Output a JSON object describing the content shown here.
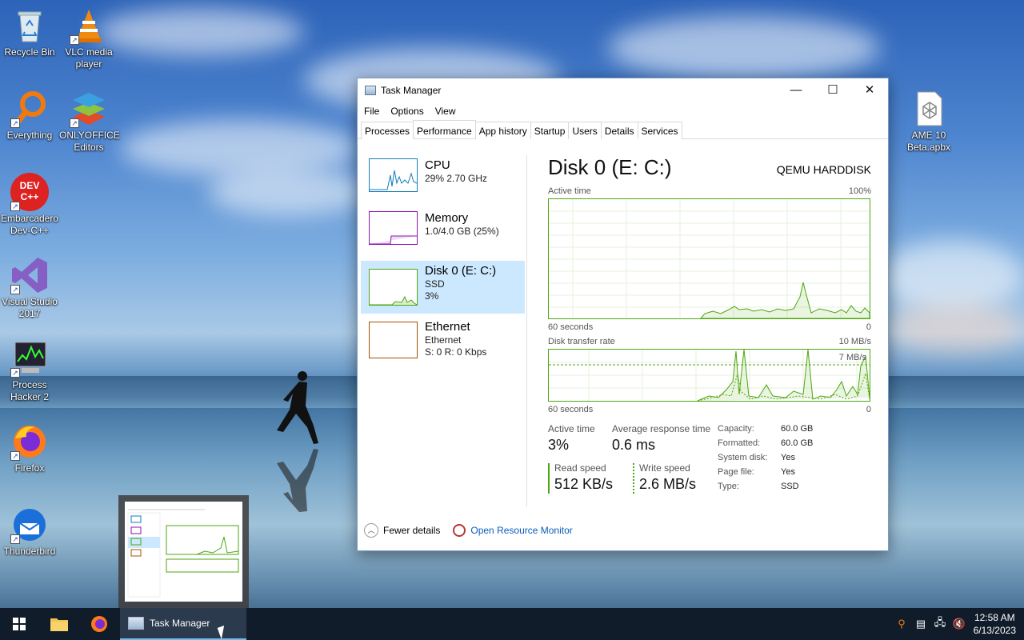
{
  "desktop": {
    "icons": [
      {
        "label": "Recycle Bin",
        "icon": "recycle-bin-icon"
      },
      {
        "label": "VLC media player",
        "icon": "vlc-icon"
      },
      {
        "label": "Everything",
        "icon": "everything-search-icon"
      },
      {
        "label": "ONLYOFFICE Editors",
        "icon": "onlyoffice-icon"
      },
      {
        "label": "Embarcadero Dev-C++",
        "icon": "devcpp-icon",
        "glyph": "DEV C++"
      },
      {
        "label": "Visual Studio 2017",
        "icon": "visual-studio-icon"
      },
      {
        "label": "Process Hacker 2",
        "icon": "process-hacker-icon"
      },
      {
        "label": "Firefox",
        "icon": "firefox-icon"
      },
      {
        "label": "Thunderbird",
        "icon": "thunderbird-icon"
      },
      {
        "label": "AME 10 Beta.apbx",
        "icon": "apbx-file-icon"
      }
    ]
  },
  "task_manager": {
    "title": "Task Manager",
    "window_buttons": {
      "minimize": "—",
      "maximize": "☐",
      "close": "✕"
    },
    "menu": [
      "File",
      "Options",
      "View"
    ],
    "tabs": [
      "Processes",
      "Performance",
      "App history",
      "Startup",
      "Users",
      "Details",
      "Services"
    ],
    "active_tab": "Performance",
    "sidebar": [
      {
        "name": "CPU",
        "sub1": "29%  2.70 GHz",
        "sub2": "",
        "color": "#117dbb"
      },
      {
        "name": "Memory",
        "sub1": "1.0/4.0 GB (25%)",
        "sub2": "",
        "color": "#8b12ae"
      },
      {
        "name": "Disk 0 (E: C:)",
        "sub1": "SSD",
        "sub2": "3%",
        "color": "#4da60c"
      },
      {
        "name": "Ethernet",
        "sub1": "Ethernet",
        "sub2": "S: 0  R: 0 Kbps",
        "color": "#a74f01"
      }
    ],
    "selected_item": "Disk 0 (E: C:)",
    "detail": {
      "title": "Disk 0 (E: C:)",
      "model": "QEMU HARDDISK",
      "active_time_label": "Active time",
      "active_time_max": "100%",
      "axis_left": "60 seconds",
      "axis_right": "0",
      "transfer_label": "Disk transfer rate",
      "transfer_max": "10 MB/s",
      "transfer_marker": "7 MB/s",
      "stats": {
        "active_time_label": "Active time",
        "active_time_value": "3%",
        "avg_response_label": "Average response time",
        "avg_response_value": "0.6 ms",
        "read_label": "Read speed",
        "read_value": "512 KB/s",
        "write_label": "Write speed",
        "write_value": "2.6 MB/s"
      },
      "properties": [
        {
          "key": "Capacity:",
          "value": "60.0 GB"
        },
        {
          "key": "Formatted:",
          "value": "60.0 GB"
        },
        {
          "key": "System disk:",
          "value": "Yes"
        },
        {
          "key": "Page file:",
          "value": "Yes"
        },
        {
          "key": "Type:",
          "value": "SSD"
        }
      ]
    },
    "footer": {
      "fewer_details": "Fewer details",
      "resource_monitor": "Open Resource Monitor"
    }
  },
  "taskbar": {
    "task_label": "Task Manager",
    "clock_time": "12:58 AM",
    "clock_date": "6/13/2023"
  }
}
